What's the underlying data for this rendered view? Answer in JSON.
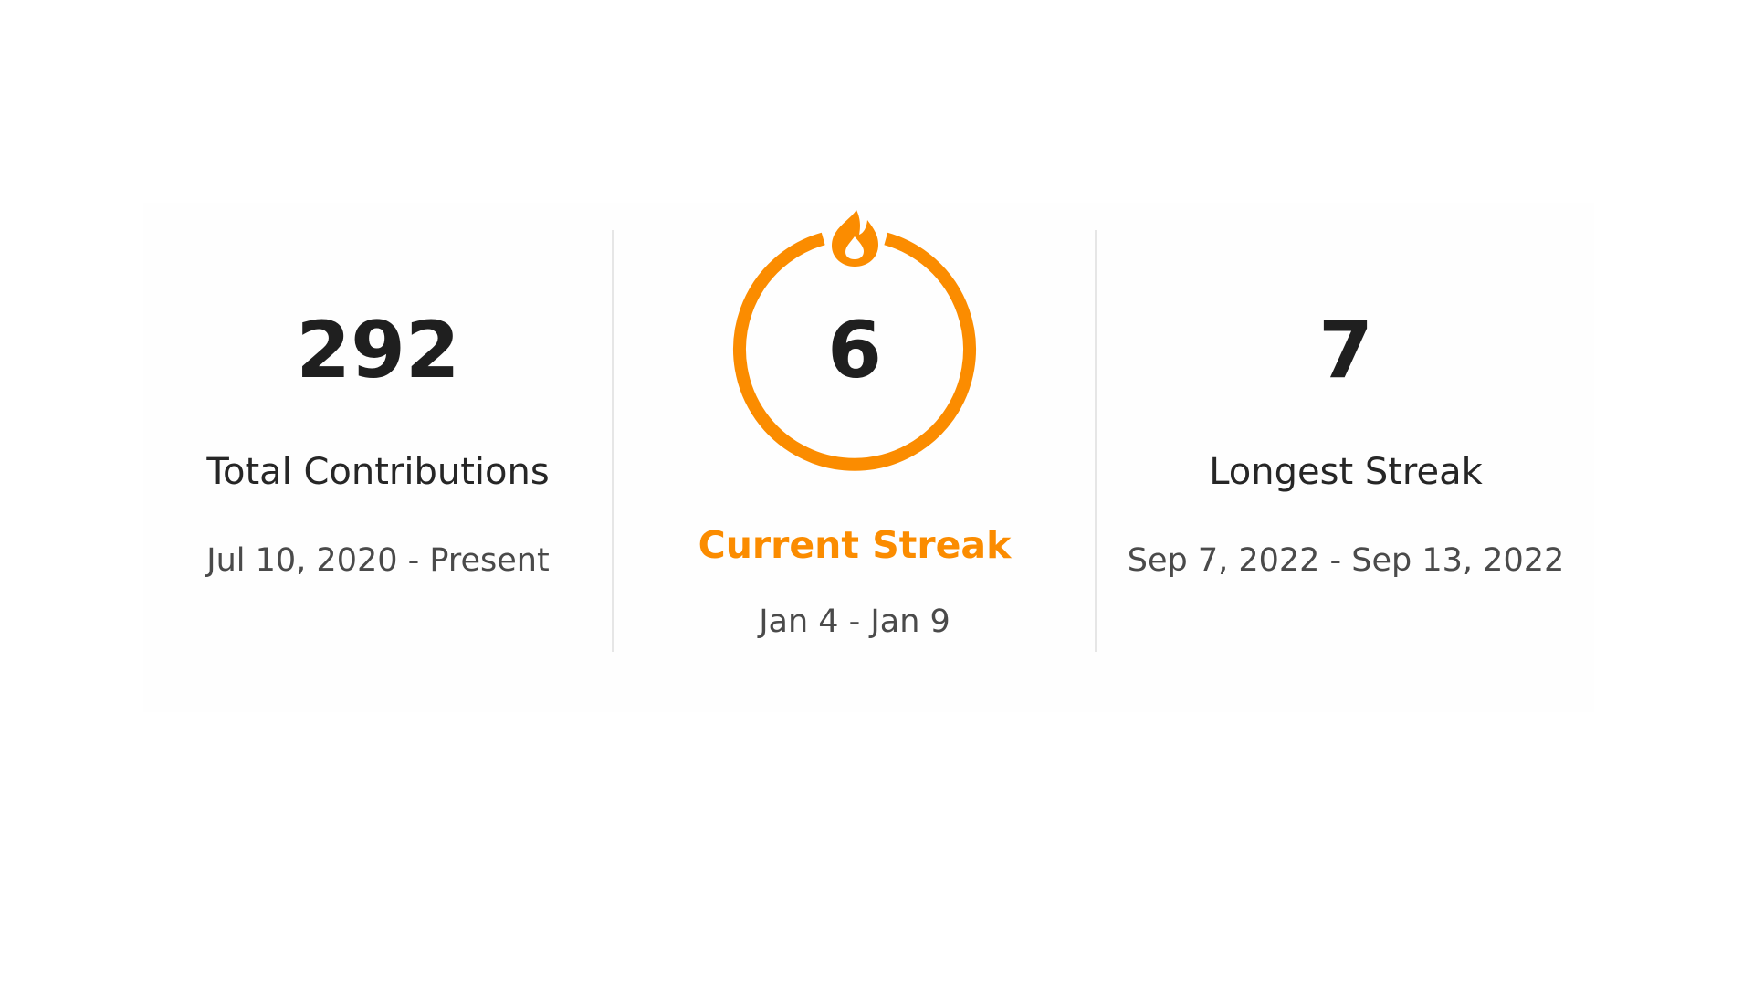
{
  "colors": {
    "accent": "#fb8c00",
    "number": "#1f1f1f",
    "label": "#262626",
    "range": "#4a4a4a",
    "divider": "#e6e6e6",
    "card_background": "#fefefe",
    "page_background": "#ffffff"
  },
  "total": {
    "value": "292",
    "label": "Total Contributions",
    "range": "Jul 10, 2020 - Present"
  },
  "current": {
    "value": "6",
    "label": "Current Streak",
    "range": "Jan 4 - Jan 9",
    "icon": "fire-icon"
  },
  "longest": {
    "value": "7",
    "label": "Longest Streak",
    "range": "Sep 7, 2022 - Sep 13, 2022"
  }
}
